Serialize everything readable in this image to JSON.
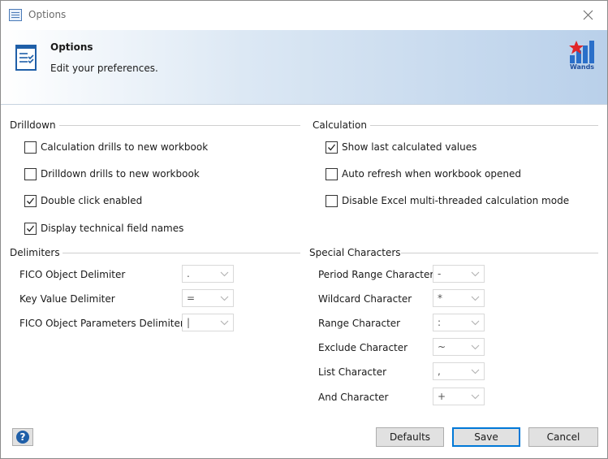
{
  "window": {
    "title": "Options"
  },
  "header": {
    "title": "Options",
    "subtitle": "Edit your preferences.",
    "logo_text": "Wands"
  },
  "drilldown": {
    "title": "Drilldown",
    "items": [
      {
        "label": "Calculation drills to new workbook",
        "checked": false
      },
      {
        "label": "Drilldown drills to new workbook",
        "checked": false
      },
      {
        "label": "Double click enabled",
        "checked": true
      },
      {
        "label": "Display technical field names",
        "checked": true
      }
    ]
  },
  "calculation": {
    "title": "Calculation",
    "items": [
      {
        "label": "Show last calculated values",
        "checked": true
      },
      {
        "label": "Auto refresh when workbook opened",
        "checked": false
      },
      {
        "label": "Disable Excel multi-threaded calculation mode",
        "checked": false
      }
    ]
  },
  "delimiters": {
    "title": "Delimiters",
    "fields": [
      {
        "label": "FICO Object Delimiter",
        "value": "."
      },
      {
        "label": "Key Value Delimiter",
        "value": "="
      },
      {
        "label": "FICO Object Parameters Delimiter",
        "value": "|"
      }
    ]
  },
  "special_characters": {
    "title": "Special Characters",
    "fields": [
      {
        "label": "Period Range Character",
        "value": "-"
      },
      {
        "label": "Wildcard Character",
        "value": "*"
      },
      {
        "label": "Range Character",
        "value": ":"
      },
      {
        "label": "Exclude Character",
        "value": "~"
      },
      {
        "label": "List Character",
        "value": ","
      },
      {
        "label": "And Character",
        "value": "+"
      }
    ]
  },
  "footer": {
    "help_label": "?",
    "defaults_label": "Defaults",
    "save_label": "Save",
    "cancel_label": "Cancel"
  }
}
